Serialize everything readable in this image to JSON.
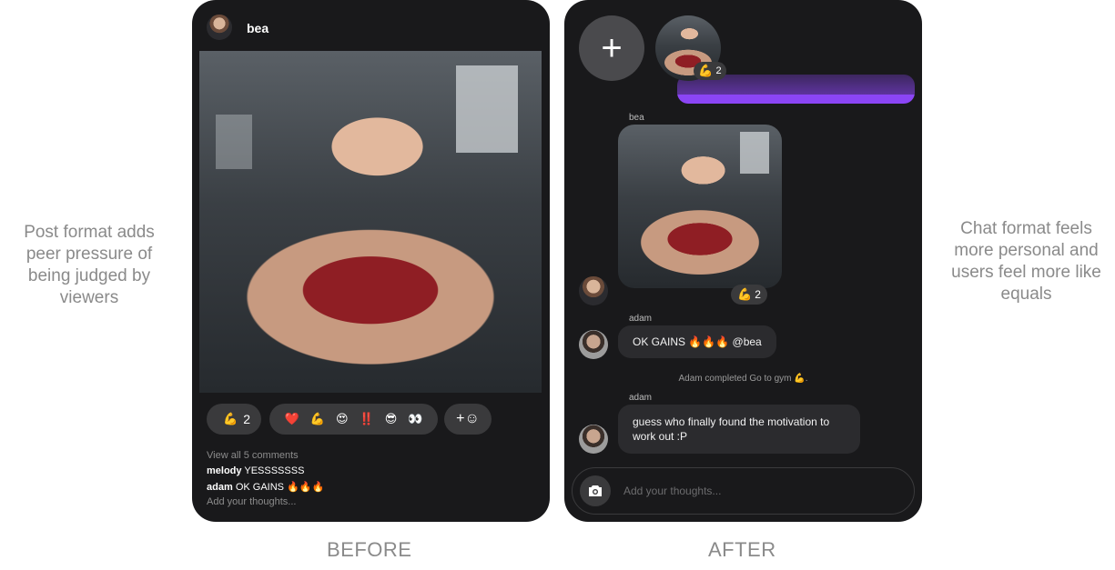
{
  "left_caption": "Post format adds\npeer pressure of\nbeing judged by\nviewers",
  "right_caption": "Chat format feels\nmore personal and\nusers feel more like\nequals",
  "before_label": "BEFORE",
  "after_label": "AFTER",
  "before": {
    "username": "bea",
    "reaction_badge": {
      "emoji": "💪",
      "count": "2"
    },
    "reaction_options": [
      "❤️",
      "💪",
      "😍",
      "‼️",
      "😎",
      "👀"
    ],
    "add_reaction_label": "+☺",
    "view_comments": "View all 5 comments",
    "comments": [
      {
        "user": "melody",
        "text": "YESSSSSSS"
      },
      {
        "user": "adam",
        "text": "OK GAINS 🔥🔥🔥"
      }
    ],
    "add_thoughts_placeholder": "Add your thoughts..."
  },
  "after": {
    "plus_label": "+",
    "story_reaction": {
      "emoji": "💪",
      "count": "2"
    },
    "messages": {
      "bea_name": "bea",
      "bea_reaction": {
        "emoji": "💪",
        "count": "2"
      },
      "adam_name_1": "adam",
      "adam_msg_1": "OK GAINS 🔥🔥🔥 @bea",
      "system_msg": "Adam completed Go to gym 💪.",
      "adam_name_2": "adam",
      "adam_msg_2": "guess who finally found the motivation to work out :P"
    },
    "input_placeholder": "Add your thoughts...",
    "accent_color": "#8b45f5"
  }
}
